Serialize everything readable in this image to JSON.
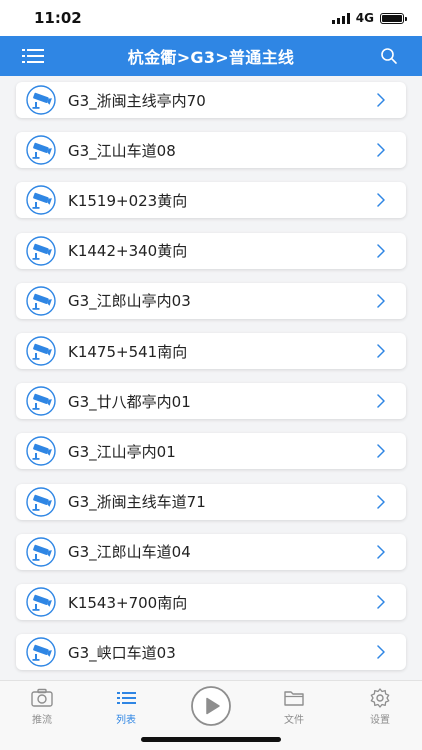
{
  "status_bar": {
    "time": "11:02",
    "network": "4G"
  },
  "nav": {
    "title": "杭金衢>G3>普通主线"
  },
  "items": [
    {
      "label": "G3_浙闽主线亭内70"
    },
    {
      "label": "G3_江山车道08"
    },
    {
      "label": "K1519+023黄向"
    },
    {
      "label": "K1442+340黄向"
    },
    {
      "label": "G3_江郎山亭内03"
    },
    {
      "label": "K1475+541南向"
    },
    {
      "label": "G3_廿八都亭内01"
    },
    {
      "label": "G3_江山亭内01"
    },
    {
      "label": "G3_浙闽主线车道71"
    },
    {
      "label": "G3_江郎山车道04"
    },
    {
      "label": "K1543+700南向"
    },
    {
      "label": "G3_峡口车道03"
    }
  ],
  "tabs": [
    {
      "label": "推流",
      "icon": "camera-icon"
    },
    {
      "label": "列表",
      "icon": "list-icon",
      "active": true
    },
    {
      "label": "",
      "icon": "play-icon"
    },
    {
      "label": "文件",
      "icon": "folder-icon"
    },
    {
      "label": "设置",
      "icon": "gear-icon"
    }
  ],
  "colors": {
    "accent": "#2f86e4",
    "tab_inactive": "#8e8e8e"
  }
}
